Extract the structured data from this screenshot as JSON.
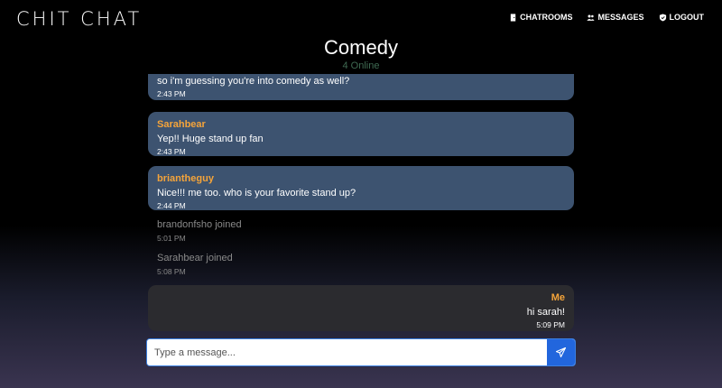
{
  "brand": "CHIT CHAT",
  "nav": {
    "chatrooms": "CHATROOMS",
    "messages": "MESSAGES",
    "logout": "LOGOUT"
  },
  "room": {
    "title": "Comedy",
    "online": "4 Online"
  },
  "messages": [
    {
      "text": "so i'm guessing you're into comedy as well?",
      "time": "2:43 PM"
    },
    {
      "user": "Sarahbear",
      "text": "Yep!! Huge stand up fan",
      "time": "2:43 PM"
    },
    {
      "user": "briantheguy",
      "text": "Nice!!! me too. who is your favorite stand up?",
      "time": "2:44 PM"
    }
  ],
  "system": [
    {
      "text": "brandonfsho joined",
      "time": "5:01 PM"
    },
    {
      "text": "Sarahbear joined",
      "time": "5:08 PM"
    }
  ],
  "my_message": {
    "user": "Me",
    "text": "hi sarah!",
    "time": "5:09 PM"
  },
  "composer": {
    "placeholder": "Type a message..."
  },
  "colors": {
    "accent": "#2266dd",
    "username": "#f5a43a",
    "bubble": "#3d5370",
    "my_bubble": "#2b2b2f",
    "online": "#3f6a52"
  },
  "icons": {
    "chatrooms": "door-icon",
    "messages": "users-icon",
    "logout": "shield-icon",
    "send": "paper-plane-icon"
  }
}
